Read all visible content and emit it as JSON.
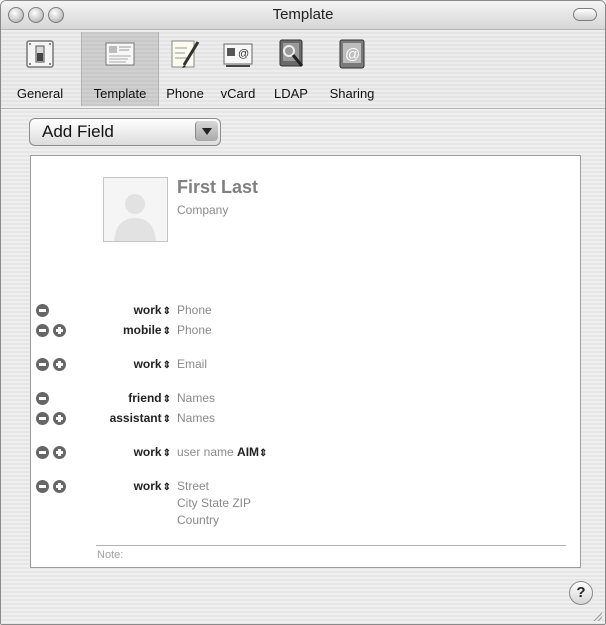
{
  "window": {
    "title": "Template"
  },
  "toolbar": {
    "items": [
      {
        "label": "General",
        "icon": "switch-icon"
      },
      {
        "label": "Template",
        "icon": "template-icon",
        "selected": true
      },
      {
        "label": "Phone",
        "icon": "phone-note-icon"
      },
      {
        "label": "vCard",
        "icon": "vcard-icon"
      },
      {
        "label": "LDAP",
        "icon": "ldap-icon"
      },
      {
        "label": "Sharing",
        "icon": "sharing-icon"
      }
    ]
  },
  "add_field": {
    "label": "Add Field"
  },
  "card": {
    "name": "First Last",
    "company": "Company",
    "fields": [
      {
        "label": "work",
        "value": "Phone"
      },
      {
        "label": "mobile",
        "value": "Phone"
      },
      {
        "label": "work",
        "value": "Email"
      },
      {
        "label": "friend",
        "value": "Names"
      },
      {
        "label": "assistant",
        "value": "Names"
      },
      {
        "label": "work",
        "value": "user name",
        "service": "AIM"
      },
      {
        "label": "work",
        "street": "Street",
        "city_state_zip": "City State ZIP",
        "country": "Country"
      }
    ],
    "note_label": "Note:"
  },
  "help": {
    "label": "?"
  },
  "colors": {
    "window_bg": "#ececec",
    "card_bg": "#ffffff",
    "placeholder_text": "#8a8a8a",
    "button_gray": "#666666"
  }
}
